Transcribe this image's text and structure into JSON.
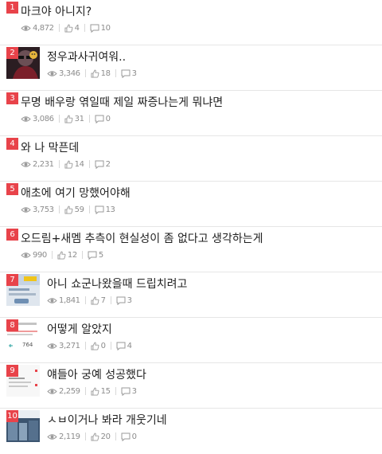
{
  "posts": [
    {
      "rank": "1",
      "title": "마크야 아니지?",
      "views": "4,872",
      "likes": "4",
      "comments": "10"
    },
    {
      "rank": "2",
      "title": "정우과사귀여워..",
      "views": "3,346",
      "likes": "18",
      "comments": "3"
    },
    {
      "rank": "3",
      "title": "무명 배우랑 엮일때 제일 짜증나는게 뭐냐면",
      "views": "3,086",
      "likes": "31",
      "comments": "0"
    },
    {
      "rank": "4",
      "title": "와 나 막픈데",
      "views": "2,231",
      "likes": "14",
      "comments": "2"
    },
    {
      "rank": "5",
      "title": "애초에 여기 망했어야해",
      "views": "3,753",
      "likes": "59",
      "comments": "13"
    },
    {
      "rank": "6",
      "title": "오드림+새멤 추측이 현실성이 좀 없다고 생각하는게",
      "views": "990",
      "likes": "12",
      "comments": "5"
    },
    {
      "rank": "7",
      "title": "아니 쇼군나왔을때 드립치려고",
      "views": "1,841",
      "likes": "7",
      "comments": "3"
    },
    {
      "rank": "8",
      "title": "어떻게 알았지",
      "views": "3,271",
      "likes": "0",
      "comments": "4",
      "thumb_text": "764"
    },
    {
      "rank": "9",
      "title": "얘들아 궁예 성공했다",
      "views": "2,259",
      "likes": "15",
      "comments": "3"
    },
    {
      "rank": "10",
      "title": "ㅅㅂ이거나 봐라 개웃기네",
      "views": "2,119",
      "likes": "20",
      "comments": "0"
    }
  ],
  "colors": {
    "rank_badge": "#e8434a",
    "meta_text": "#8c8c8c",
    "divider": "#e6e6e6"
  }
}
